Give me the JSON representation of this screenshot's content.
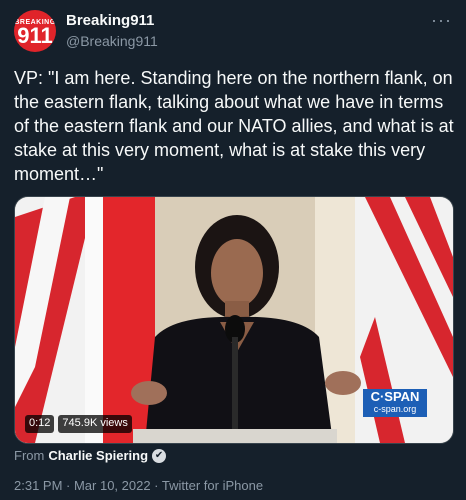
{
  "account": {
    "display_name": "Breaking911",
    "handle": "@Breaking911",
    "avatar_small": "BREAKING",
    "avatar_big": "911"
  },
  "more_icon": "more-icon",
  "tweet": {
    "text": "VP: \"I am here. Standing here on the northern flank, on the eastern flank, talking about what we have in terms of the eastern flank and our NATO allies, and what is at stake at this very moment, what is at stake this very moment…\""
  },
  "media": {
    "time": "0:12",
    "views": "745.9K views",
    "cspan_top": "C·SPAN",
    "cspan_bottom": "c-span.org"
  },
  "source": {
    "prefix": "From",
    "name": "Charlie Spiering"
  },
  "meta": {
    "time_date_client": "2:31 PM · Mar 10, 2022 · Twitter for iPhone"
  },
  "colors": {
    "background": "#15202b",
    "secondary_text": "#8b98a5",
    "cspan_blue": "#1d5fb6"
  }
}
